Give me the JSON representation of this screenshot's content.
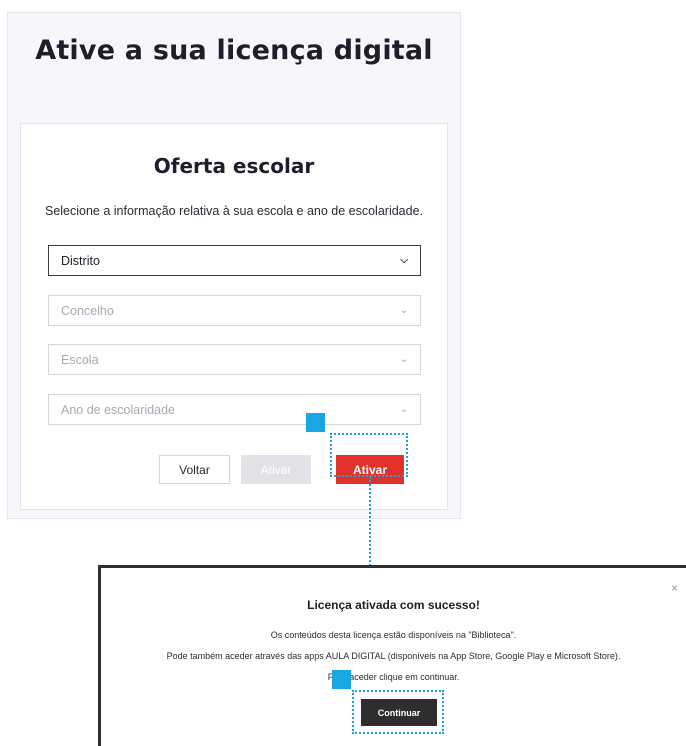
{
  "page": {
    "title": "Ative a sua licença digital"
  },
  "card": {
    "title": "Oferta escolar",
    "description": "Selecione a informação relativa à sua escola e ano de escolaridade.",
    "selects": [
      {
        "value": "Distrito"
      },
      {
        "value": "Concelho"
      },
      {
        "value": "Escola"
      },
      {
        "value": "Ano de escolaridade"
      }
    ],
    "buttons": {
      "back": "Voltar",
      "activate_disabled": "Ativar",
      "activate": "Ativar"
    }
  },
  "modal": {
    "close": "×",
    "title": "Licença ativada com sucesso!",
    "line1": "Os conteúdos desta licença estão disponíveis na \"Biblioteca\".",
    "line2": "Pode também aceder através das apps AULA DIGITAL (disponíveis na App Store, Google Play e Microsoft Store).",
    "line3": "Para aceder clique em continuar.",
    "continue": "Continuar"
  },
  "colors": {
    "accent_red": "#e0322a",
    "highlight_blue": "#19a6e3",
    "dark_button": "#2e2e2e"
  }
}
